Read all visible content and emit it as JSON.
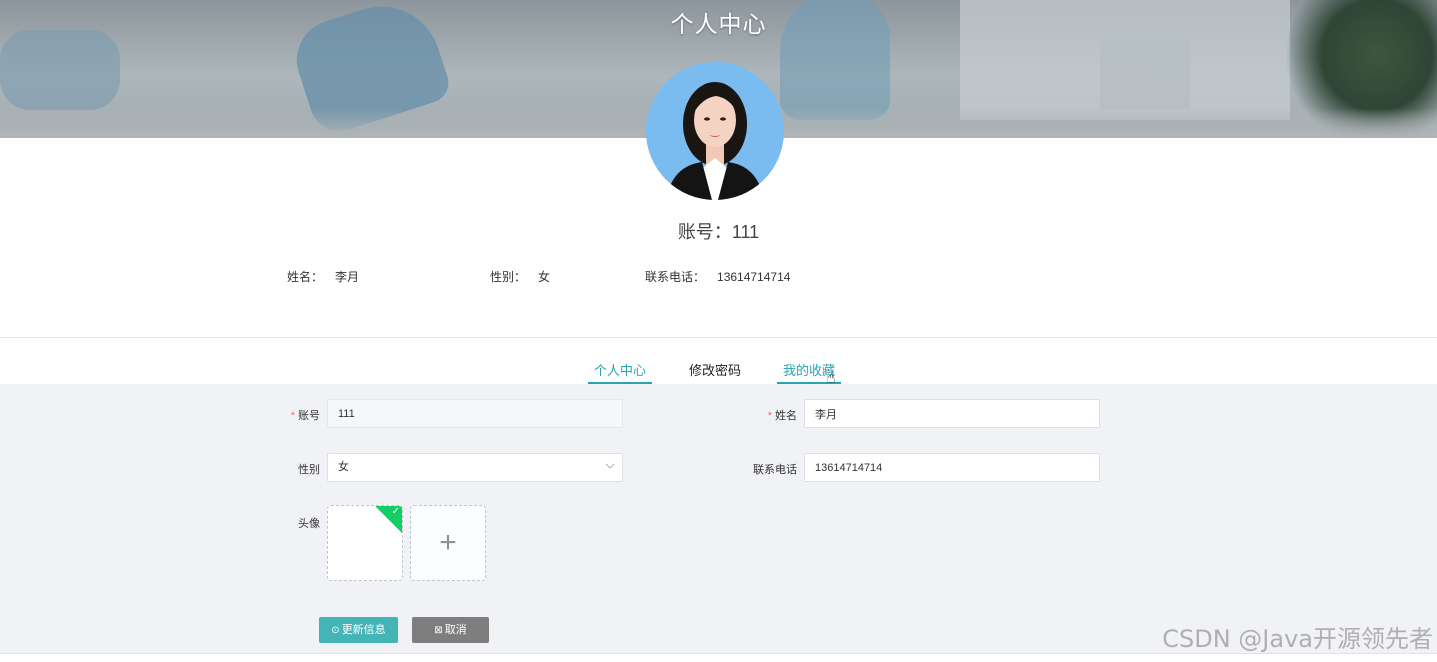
{
  "header": {
    "title": "个人中心"
  },
  "profile": {
    "account_label": "账号：",
    "account_value": "111",
    "name_label": "姓名：",
    "name_value": "李月",
    "gender_label": "性别：",
    "gender_value": "女",
    "phone_label": "联系电话：",
    "phone_value": "13614714714"
  },
  "tabs": [
    {
      "label": "个人中心",
      "state": "active"
    },
    {
      "label": "修改密码",
      "state": "normal"
    },
    {
      "label": "我的收藏",
      "state": "hover"
    }
  ],
  "form": {
    "account": {
      "label": "账号",
      "required": "*",
      "value": "111"
    },
    "name": {
      "label": "姓名",
      "required": "*",
      "value": "李月"
    },
    "gender": {
      "label": "性别",
      "value": "女"
    },
    "phone": {
      "label": "联系电话",
      "value": "13614714714"
    },
    "avatar": {
      "label": "头像",
      "add_symbol": "+"
    }
  },
  "buttons": {
    "update": {
      "icon": "⊙",
      "label": "更新信息"
    },
    "cancel": {
      "icon": "⊠",
      "label": "取消"
    }
  },
  "watermark": "CSDN @Java开源领先者",
  "colors": {
    "accent": "#2aa3b4",
    "update_button": "#43b5b6",
    "cancel_button": "#7e7e7e",
    "required": "#f56c6c",
    "upload_success": "#13ce66"
  },
  "icons": {
    "select_arrow": "chevron-down-icon",
    "upload_check": "check-icon",
    "add": "plus-icon"
  }
}
